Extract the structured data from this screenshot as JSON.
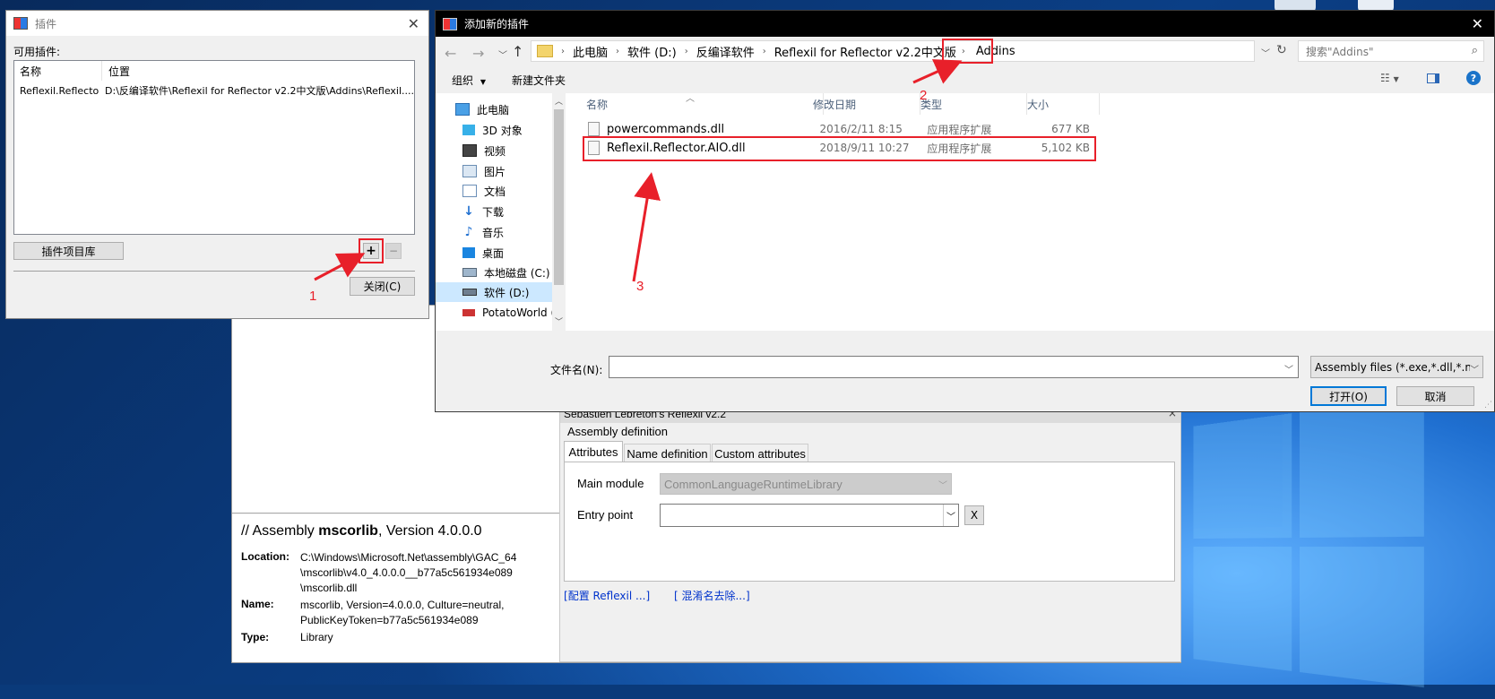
{
  "plugin_dialog": {
    "title": "插件",
    "available_label": "可用插件:",
    "columns": [
      "名称",
      "位置"
    ],
    "rows": [
      {
        "name": "Reflexil.Reflecto...",
        "location": "D:\\反编译软件\\Reflexil for Reflector v2.2中文版\\Addins\\Reflexil...."
      }
    ],
    "gallery_button": "插件项目库",
    "add_button": "+",
    "remove_button": "−",
    "close_button": "关闭(C)"
  },
  "file_dialog": {
    "title": "添加新的插件",
    "breadcrumb": [
      "此电脑",
      "软件 (D:)",
      "反编译软件",
      "Reflexil for Reflector v2.2中文版",
      "Addins"
    ],
    "search_placeholder": "搜索\"Addins\"",
    "toolbar": {
      "organize": "组织",
      "new_folder": "新建文件夹"
    },
    "nav": [
      "此电脑",
      "3D 对象",
      "视频",
      "图片",
      "文档",
      "下载",
      "音乐",
      "桌面",
      "本地磁盘 (C:)",
      "软件 (D:)",
      "PotatoWorld (Z"
    ],
    "columns": {
      "name": "名称",
      "date": "修改日期",
      "type": "类型",
      "size": "大小"
    },
    "files": [
      {
        "name": "powercommands.dll",
        "date": "2016/2/11 8:15",
        "type": "应用程序扩展",
        "size": "677 KB"
      },
      {
        "name": "Reflexil.Reflector.AIO.dll",
        "date": "2018/9/11 10:27",
        "type": "应用程序扩展",
        "size": "5,102 KB"
      }
    ],
    "filename_label": "文件名(N):",
    "filename_value": "",
    "filter": "Assembly files (*.exe,*.dll,*.m",
    "open_button": "打开(O)",
    "cancel_button": "取消"
  },
  "annotations": [
    "1",
    "2",
    "3"
  ],
  "assembly_info": {
    "header_prefix": "// Assembly ",
    "header_name": "mscorlib",
    "header_suffix": ", Version 4.0.0.0",
    "location_label": "Location:",
    "location_lines": [
      "C:\\Windows\\Microsoft.Net\\assembly\\GAC_64",
      "\\mscorlib\\v4.0_4.0.0.0__b77a5c561934e089",
      "\\mscorlib.dll"
    ],
    "name_label": "Name:",
    "name_lines": [
      "mscorlib, Version=4.0.0.0, Culture=neutral,",
      "PublicKeyToken=b77a5c561934e089"
    ],
    "type_label": "Type:",
    "type_value": "Library"
  },
  "reflexil": {
    "title": "Sebastien Lebreton's Reflexil v2.2",
    "group": "Assembly definition",
    "tabs": [
      "Attributes",
      "Name definition",
      "Custom attributes"
    ],
    "main_module_label": "Main module",
    "main_module_value": "CommonLanguageRuntimeLibrary",
    "entry_point_label": "Entry point",
    "entry_point_value": "",
    "clear_button": "X",
    "link_configure": "配置 Reflexil ...]",
    "link_obfuscation": "[ 混淆名去除...]"
  }
}
